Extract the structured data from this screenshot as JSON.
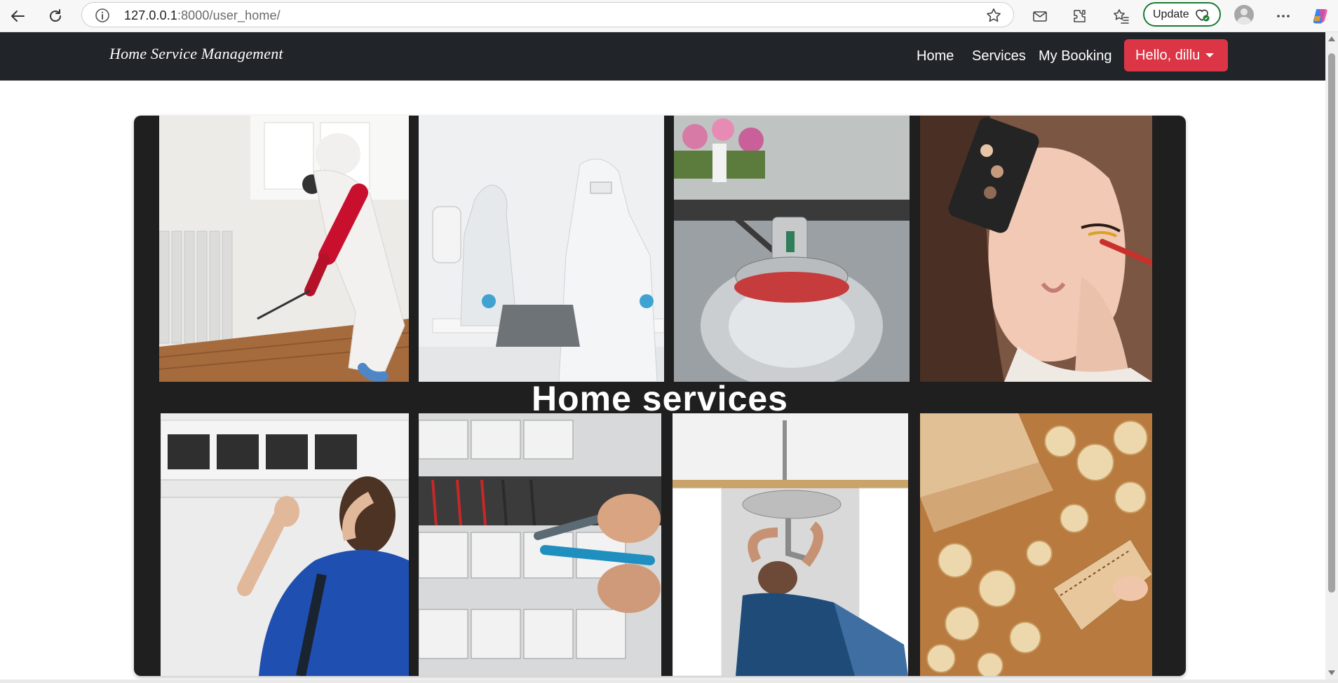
{
  "browser": {
    "url_host": "127.0.0.1",
    "url_path": ":8000/user_home/",
    "update_label": "Update"
  },
  "navbar": {
    "brand": "Home Service Management",
    "links": [
      {
        "label": "Home"
      },
      {
        "label": "Services"
      },
      {
        "label": "My Booking"
      }
    ],
    "user_label": "Hello, dillu",
    "user_button_color": "#dc3545",
    "background_color": "#212529"
  },
  "hero": {
    "title": "Home services",
    "tiles": [
      {
        "subject": "pest-control-spraying"
      },
      {
        "subject": "disinfection-cleaning"
      },
      {
        "subject": "floor-scrubbing"
      },
      {
        "subject": "makeup-beauty"
      },
      {
        "subject": "ac-repair"
      },
      {
        "subject": "electrical-panel-repair"
      },
      {
        "subject": "plumbing-under-sink"
      },
      {
        "subject": "carpentry-woodwork"
      }
    ]
  }
}
